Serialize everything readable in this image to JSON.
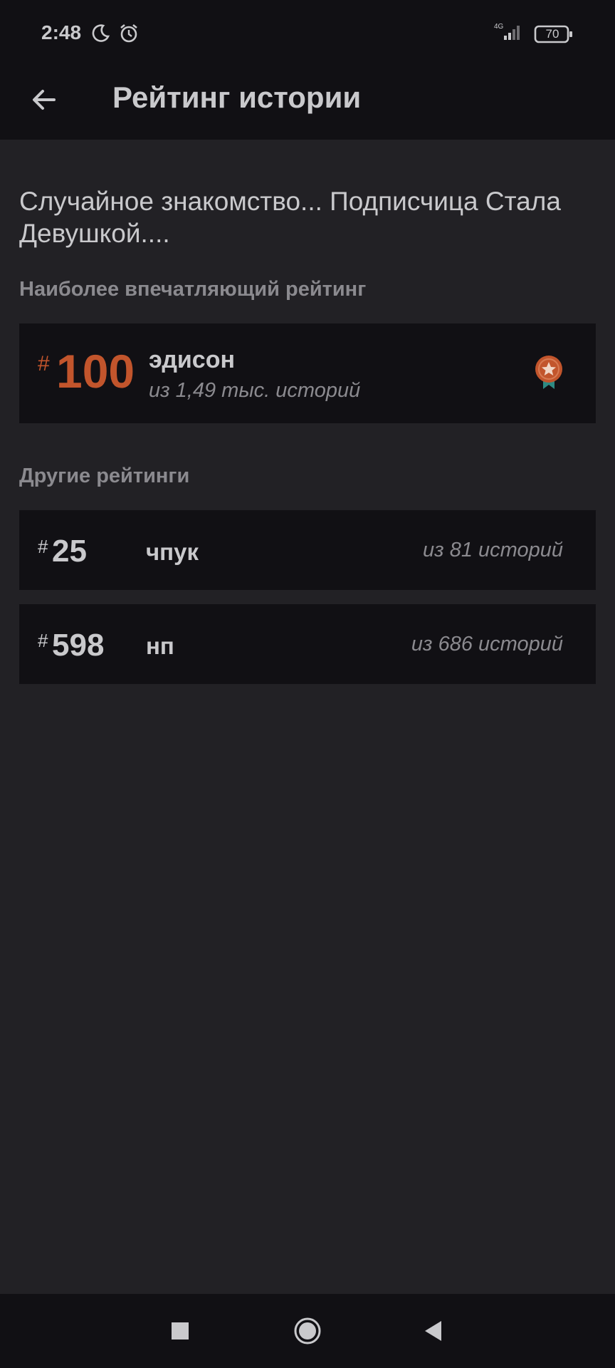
{
  "status": {
    "time": "2:48",
    "network": "4G",
    "battery": "70",
    "icons": [
      "moon-icon",
      "alarm-icon",
      "signal-icon",
      "battery-icon"
    ]
  },
  "appbar": {
    "title": "Рейтинг истории",
    "back_icon": "arrow-left-icon"
  },
  "story": {
    "title": "Случайное знакомство... Подписчица Стала Девушкой...."
  },
  "top_rating": {
    "section_label": "Наиболее впечатляющий рейтинг",
    "hash": "#",
    "rank": "100",
    "tag": "эдисон",
    "subtitle": "из 1,49 тыс. историй",
    "badge_icon": "medal-star-icon"
  },
  "other_ratings": {
    "section_label": "Другие рейтинги",
    "items": [
      {
        "hash": "#",
        "rank": "25",
        "tag": "чпук",
        "subtitle": "из 81 историй"
      },
      {
        "hash": "#",
        "rank": "598",
        "tag": "нп",
        "subtitle": "из 686 историй"
      }
    ]
  },
  "colors": {
    "background": "#222125",
    "bar": "#111014",
    "accent": "#c2552c",
    "text": "#c9c9cc",
    "muted": "#8b8a8f"
  }
}
